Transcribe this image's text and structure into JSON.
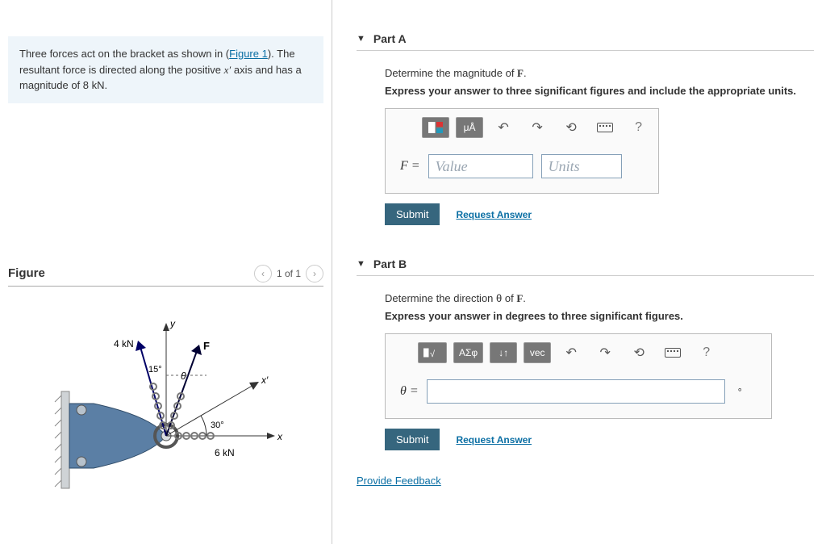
{
  "problem": {
    "text_1": "Three forces act on the bracket as shown in (",
    "figure_link": "Figure 1",
    "text_2": "). The resultant force is directed along the positive ",
    "axis_symbol": "x′",
    "text_3": " axis and has a magnitude of ",
    "magnitude": "8 kN",
    "text_4": "."
  },
  "figure": {
    "title": "Figure",
    "page_indicator": "1 of 1",
    "labels": {
      "y": "y",
      "x": "x",
      "xprime": "x′",
      "F": "F",
      "theta": "θ",
      "a15": "15°",
      "a30": "30°",
      "f4": "4 kN",
      "f6": "6 kN"
    }
  },
  "partA": {
    "title": "Part A",
    "prompt_pre": "Determine the magnitude of ",
    "prompt_sym": "F",
    "prompt_post": ".",
    "instruction": "Express your answer to three significant figures and include the appropriate units.",
    "var": "F =",
    "value_placeholder": "Value",
    "units_placeholder": "Units",
    "toolbar": {
      "units_btn": "μÅ"
    },
    "submit": "Submit",
    "request": "Request Answer"
  },
  "partB": {
    "title": "Part B",
    "prompt_pre": "Determine the direction ",
    "prompt_theta": "θ",
    "prompt_mid": " of ",
    "prompt_sym": "F",
    "prompt_post": ".",
    "instruction": "Express your answer in degrees to three significant figures.",
    "var": "θ =",
    "toolbar": {
      "greek": "ΑΣφ",
      "updown": "↓↑",
      "vec": "vec"
    },
    "suffix": "°",
    "submit": "Submit",
    "request": "Request Answer"
  },
  "feedback": "Provide Feedback"
}
